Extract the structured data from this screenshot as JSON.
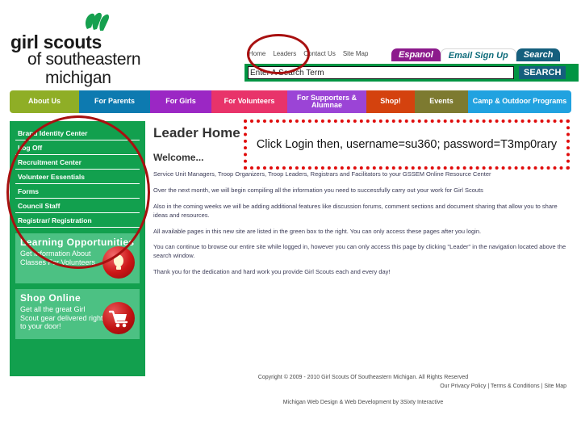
{
  "site": {
    "logo": {
      "line1": "girl scouts",
      "line2": "of southeastern",
      "line3": "michigan",
      "trefoil_color": "#16a04f"
    }
  },
  "header": {
    "utility_nav": [
      "Home",
      "Leaders",
      "Contact Us",
      "Site Map"
    ],
    "tabs": [
      {
        "label": "Espanol",
        "bg": "#8c1a8c",
        "fg": "#ffffff"
      },
      {
        "label": "Email Sign Up",
        "bg": "#ffffff",
        "fg": "#0d6b7a"
      },
      {
        "label": "Search",
        "bg": "#155f7d",
        "fg": "#ffffff"
      }
    ],
    "search": {
      "placeholder": "Enter A Search Term",
      "value": "Enter A Search Term",
      "button_label": "SEARCH",
      "bar_color": "#009543",
      "button_color": "#155f7d"
    }
  },
  "main_nav": [
    {
      "label": "About Us",
      "color": "#8fae26"
    },
    {
      "label": "For Parents",
      "color": "#0d7ab0"
    },
    {
      "label": "For Girls",
      "color": "#9b27c4"
    },
    {
      "label": "For Volunteers",
      "color": "#e8336a"
    },
    {
      "label": "For Supporters & Alumnae",
      "color": "#9b44d6"
    },
    {
      "label": "Shop!",
      "color": "#d4420e"
    },
    {
      "label": "Events",
      "color": "#7d7a30"
    },
    {
      "label": "Camp & Outdoor Programs",
      "color": "#21a2e0"
    }
  ],
  "sidebar": {
    "bg_color": "#12a04e",
    "links": [
      "Brand Identity Center",
      "Log Off",
      "Recruitment Center",
      "Volunteer Essentials",
      "Forms",
      "Council Staff",
      "Registrar/ Registration"
    ],
    "promos": [
      {
        "title": "Learning Opportunities",
        "body": "Get Information About Classes For Volunteers",
        "icon": "lightbulb-icon"
      },
      {
        "title": "Shop Online",
        "body": "Get all the great Girl Scout gear delivered right to your door!",
        "icon": "shopping-cart-icon"
      }
    ]
  },
  "content": {
    "page_title": "Leader Home",
    "welcome_heading": "Welcome...",
    "paragraphs": [
      "Service Unit Managers, Troop Organizers, Troop Leaders, Registrars and Facilitators to your GSSEM Online Resource Center",
      "Over the next month, we will begin compiling all the information you need to successfully carry out your work for Girl Scouts",
      "Also in the coming weeks we will be adding additional features like discussion forums, comment sections and document sharing that allow you to share ideas and resources.",
      "All available pages in this new site are listed in the green box to the right.  You can only access these pages after you login.",
      "You can continue to browse our entire site while logged in, however you can only access this page by clicking \"Leader\" in the navigation located above the search window.",
      "Thank you for the dedication and hard work you provide Girl Scouts each and every day!"
    ]
  },
  "footer": {
    "copyright": "Copyright © 2009 - 2010 Girl Scouts Of Southeastern Michigan. All Rights Reserved",
    "links": "Our Privacy Policy | Terms & Conditions | Site Map",
    "credit": "Michigan Web Design & Web Development by 3Sixty Interactive"
  },
  "annotations": {
    "callout_text": "Click Login then, username=su360; password=T3mp0rary",
    "callout_border_color": "#e00d0d",
    "circle_color": "#a81010"
  }
}
